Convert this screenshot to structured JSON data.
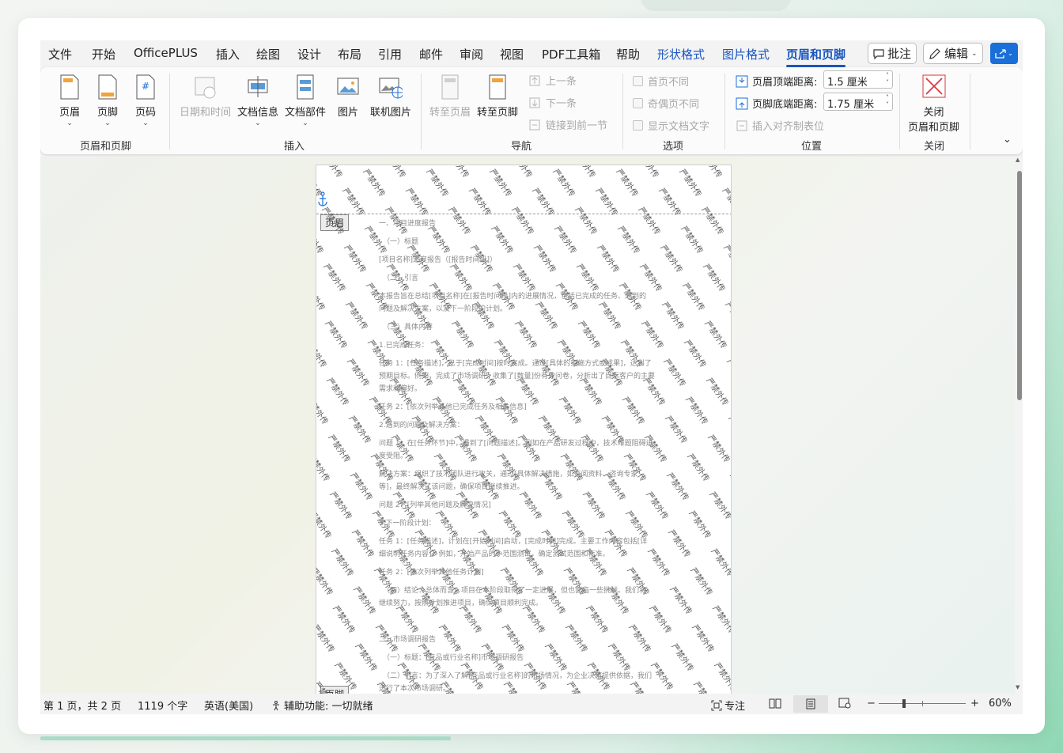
{
  "menu": {
    "tabs": [
      "文件",
      "开始",
      "OfficePLUS",
      "插入",
      "绘图",
      "设计",
      "布局",
      "引用",
      "邮件",
      "审阅",
      "视图",
      "PDF工具箱",
      "帮助",
      "形状格式",
      "图片格式",
      "页眉和页脚"
    ],
    "comment_label": "批注",
    "edit_label": "编辑"
  },
  "ribbon": {
    "hf_group": {
      "header": "页眉",
      "footer": "页脚",
      "page_number": "页码",
      "label": "页眉和页脚"
    },
    "insert_group": {
      "datetime": "日期和时间",
      "docinfo": "文档信息",
      "quickparts": "文档部件",
      "picture": "图片",
      "online_picture": "联机图片",
      "label": "插入"
    },
    "nav_group": {
      "goto_header": "转至页眉",
      "goto_footer": "转至页脚",
      "prev": "上一条",
      "next": "下一条",
      "link_prev": "链接到前一节",
      "label": "导航"
    },
    "options_group": {
      "first_page": "首页不同",
      "odd_even": "奇偶页不同",
      "show_text": "显示文档文字",
      "label": "选项"
    },
    "position_group": {
      "header_top": "页眉顶端距离:",
      "header_top_value": "1.5 厘米",
      "footer_bottom": "页脚底端距离:",
      "footer_bottom_value": "1.75 厘米",
      "align_tab": "插入对齐制表位",
      "label": "位置"
    },
    "close_group": {
      "close_line1": "关闭",
      "close_line2": "页眉和页脚",
      "label": "关闭"
    }
  },
  "document": {
    "header_tag": "页眉",
    "footer_tag": "页脚",
    "watermark_text": "严禁外传",
    "lines": [
      "一、项目进度报告",
      "（一）标题",
      "[项目名称]进度报告（[报告时间段]）",
      "（二）引言",
      "本报告旨在总结[项目名称]在[报告时间段]内的进展情况，包括已完成的任务、遇到的",
      "问题及解决方案，以及下一阶段的计划。",
      "（三）具体内容",
      "1.已完成任务：",
      "任务 1：[任务描述]，已于[完成时间]按时完成。通过[具体的实施方式或成果]，达到了",
      "预期目标。例如，完成了市场调研，收集了[数量]份有效问卷，分析出了目标客户的主要",
      "需求和偏好。",
      "任务 2：[依次列举其他已完成任务及相关信息]",
      "2.遇到的问题及解决方案：",
      "问题 1：在[任务环节]中，遇到了[问题描述]。例如在产品研发过程中，技术难题阻碍进",
      "度受阻。",
      "解决方案：组织了技术团队进行攻关，通过[具体解决措施，如查阅资料、咨询专家",
      "等]，最终解决了该问题，确保项目继续推进。",
      "问题 2：[列举其他问题及解决情况]",
      "3.下一阶段计划：",
      "任务 1：[任务描述]，计划在[开始时间]启动，[完成时间]完成。主要工作内容包括[详",
      "细说明任务内容]。例如，开始产品的小范围测试，确定测试范围和标准。",
      "任务 2：[依次列举其他任务计划]",
      "（四）结论：总体而言，项目在本阶段取得了一定进展，但也面临一些挑战。我们将",
      "继续努力，按照计划推进项目，确保项目顺利完成。",
      "二、市场调研报告",
      "（一）标题：[产品或行业名称]市场调研报告",
      "（二）引言：为了深入了解[产品或行业名称]的市场情况，为企业决策提供依据，我们",
      "进行了本次市场调研。"
    ]
  },
  "status": {
    "page": "第 1 页，共 2 页",
    "words": "1119 个字",
    "language": "英语(美国)",
    "accessibility": "辅助功能: 一切就绪",
    "focus": "专注",
    "zoom": "60%",
    "zoom_minus": "−",
    "zoom_plus": "+"
  },
  "colors": {
    "accent": "#1a56c0",
    "share": "#1a6ed8",
    "close_red": "#d9343a"
  },
  "icons": [
    "header-icon",
    "footer-icon",
    "page-number-icon",
    "datetime-icon",
    "docinfo-icon",
    "quickparts-icon",
    "picture-icon",
    "online-picture-icon",
    "goto-header-icon",
    "goto-footer-icon",
    "prev-icon",
    "next-icon",
    "link-icon",
    "close-x-icon",
    "anchor-icon"
  ]
}
